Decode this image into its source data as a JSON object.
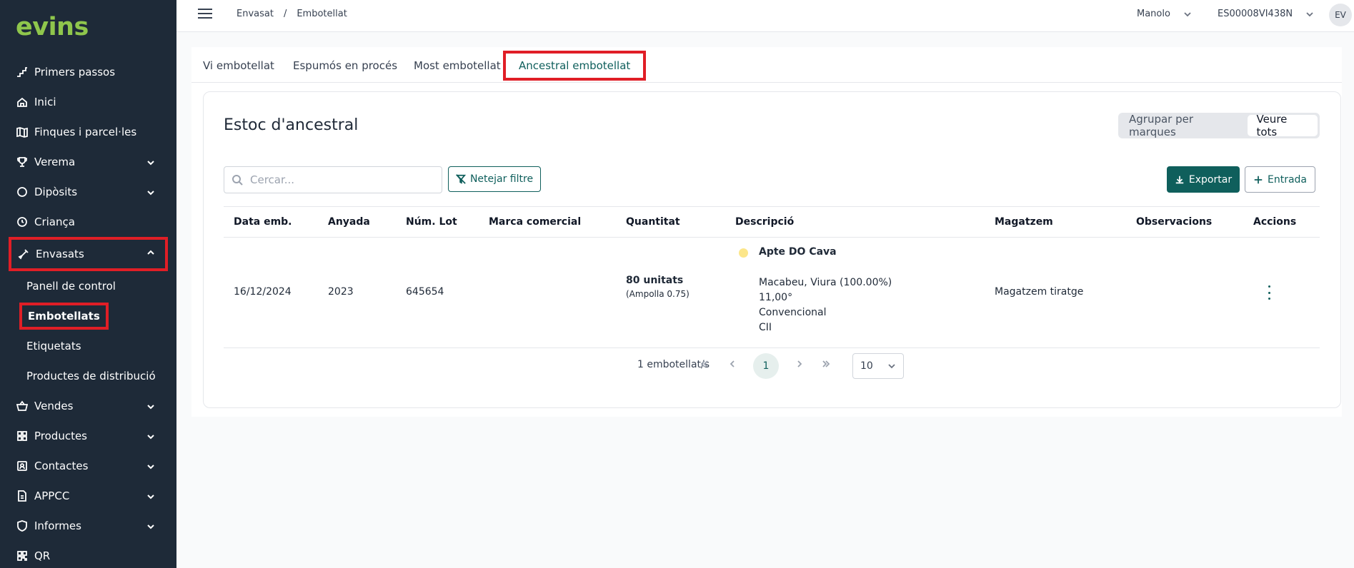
{
  "sidebar": {
    "logo_a": "ev",
    "logo_b": "ins",
    "items": [
      {
        "label": "Primers passos"
      },
      {
        "label": "Inici"
      },
      {
        "label": "Finques i parcel·les"
      },
      {
        "label": "Verema"
      },
      {
        "label": "Dipòsits"
      },
      {
        "label": "Criança"
      },
      {
        "label": "Envasats"
      },
      {
        "label": "Vendes"
      },
      {
        "label": "Productes"
      },
      {
        "label": "Contactes"
      },
      {
        "label": "APPCC"
      },
      {
        "label": "Informes"
      },
      {
        "label": "QR"
      }
    ],
    "subitems": [
      {
        "label": "Panell de control"
      },
      {
        "label": "Embotellats"
      },
      {
        "label": "Etiquetats"
      },
      {
        "label": "Productes de distribució"
      }
    ]
  },
  "topbar": {
    "crumb1": "Envasat",
    "sep": "/",
    "crumb2": "Embotellat",
    "user": "Manolo",
    "code": "ES00008VI438N",
    "avatar": "EV"
  },
  "tabs": [
    {
      "label": "Vi embotellat"
    },
    {
      "label": "Espumós en procés"
    },
    {
      "label": "Most embotellat"
    },
    {
      "label": "Ancestral embotellat"
    }
  ],
  "card": {
    "title": "Estoc d'ancestral",
    "seg_group": "Agrupar per marques",
    "seg_all": "Veure tots",
    "search_placeholder": "Cercar...",
    "clear_filter": "Netejar filtre",
    "export": "Exportar",
    "entry": "Entrada"
  },
  "table": {
    "headers": {
      "date": "Data emb.",
      "vintage": "Anyada",
      "lot": "Núm. Lot",
      "brand": "Marca comercial",
      "qty": "Quantitat",
      "desc": "Descripció",
      "warehouse": "Magatzem",
      "notes": "Observacions",
      "actions": "Accions"
    },
    "rows": [
      {
        "date": "16/12/2024",
        "vintage": "2023",
        "lot": "645654",
        "brand": "",
        "qty": "80 unitats",
        "qty_sub": "(Ampolla 0.75)",
        "desc_title": "Apte DO Cava",
        "desc_l1": "Macabeu, Viura (100.00%)",
        "desc_l2": "11,00°",
        "desc_l3": "Convencional",
        "desc_l4": "CII",
        "warehouse": "Magatzem tiratge",
        "notes": ""
      }
    ]
  },
  "pager": {
    "count": "1 embotellat/s",
    "page": "1",
    "size": "10"
  },
  "colors": {
    "sidebar_bg": "#1e2a38",
    "accent": "#0f5f5c",
    "logo": "#8fc64c",
    "highlight": "#e01e26",
    "status_dot": "#fce68a"
  }
}
